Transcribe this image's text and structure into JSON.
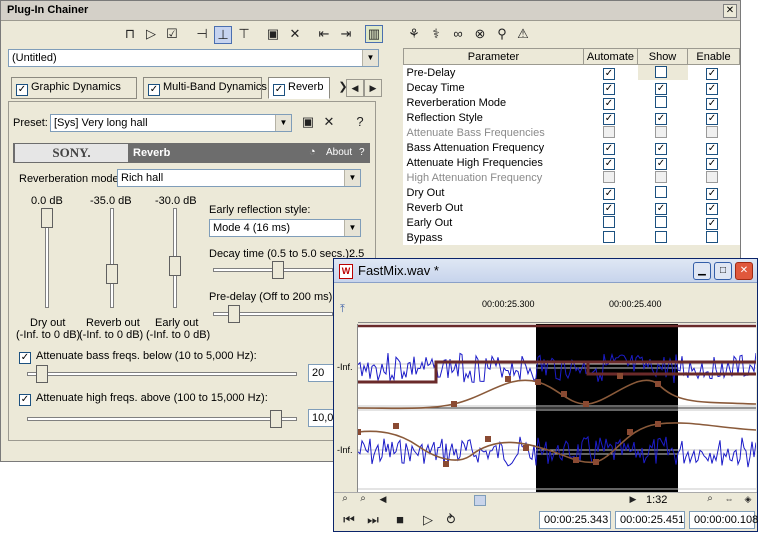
{
  "chainer": {
    "title": "Plug-In Chainer",
    "preset_combo": "(Untitled)",
    "tabs": [
      "Graphic Dynamics",
      "Multi-Band Dynamics",
      "Reverb"
    ],
    "preset_label": "Preset:",
    "preset_value": "[Sys] Very long hall",
    "brand": "SONY.",
    "plugin_name": "Reverb",
    "about_label": "About",
    "help_label": "?",
    "reverb_mode_label": "Reverberation mode:",
    "reverb_mode_value": "Rich hall",
    "slider_values": [
      "0.0 dB",
      "-35.0 dB",
      "-30.0 dB"
    ],
    "slider_levels": [
      0.0,
      -35.0,
      -30.0
    ],
    "slider_captions": [
      {
        "line1": "Dry out",
        "line2": "(-Inf. to 0 dB)"
      },
      {
        "line1": "Reverb out",
        "line2": "(-Inf. to 0 dB)"
      },
      {
        "line1": "Early out",
        "line2": "(-Inf. to 0 dB)"
      }
    ],
    "early_style_label": "Early reflection style:",
    "early_style_value": "Mode 4  (16 ms)",
    "decay_label": "Decay time (0.5 to 5.0 secs.):",
    "decay_value": "2.5",
    "predelay_label": "Pre-delay (Off to 200 ms):",
    "bass_label": "Attenuate bass freqs. below (10 to 5,000 Hz):",
    "bass_value": "20",
    "high_label": "Attenuate high freqs. above (100 to 15,000 Hz):",
    "high_value": "10,0"
  },
  "params": {
    "headers": [
      "Parameter",
      "Automate",
      "Show",
      "Enable"
    ],
    "rows": [
      {
        "name": "Pre-Delay",
        "automate": true,
        "show": false,
        "enable": true,
        "active": true
      },
      {
        "name": "Decay Time",
        "automate": true,
        "show": true,
        "enable": true,
        "active": true
      },
      {
        "name": "Reverberation Mode",
        "automate": true,
        "show": false,
        "enable": true,
        "active": true
      },
      {
        "name": "Reflection Style",
        "automate": true,
        "show": true,
        "enable": true,
        "active": true
      },
      {
        "name": "Attenuate Bass Frequencies",
        "automate": false,
        "show": false,
        "enable": false,
        "active": false
      },
      {
        "name": "Bass Attenuation Frequency",
        "automate": true,
        "show": true,
        "enable": true,
        "active": true
      },
      {
        "name": "Attenuate High Frequencies",
        "automate": true,
        "show": true,
        "enable": true,
        "active": true
      },
      {
        "name": "High Attenuation Frequency",
        "automate": false,
        "show": false,
        "enable": false,
        "active": false
      },
      {
        "name": "Dry Out",
        "automate": true,
        "show": false,
        "enable": true,
        "active": true
      },
      {
        "name": "Reverb Out",
        "automate": true,
        "show": true,
        "enable": true,
        "active": true
      },
      {
        "name": "Early Out",
        "automate": false,
        "show": false,
        "enable": true,
        "active": true
      },
      {
        "name": "Bypass",
        "automate": false,
        "show": false,
        "enable": false,
        "active": true
      }
    ]
  },
  "fastmix": {
    "title": "FastMix.wav *",
    "ruler_times": [
      "00:00:25.300",
      "00:00:25.400"
    ],
    "track_label": "-Inf.",
    "zoom": "1:32",
    "time_start": "00:00:25.343",
    "time_end": "00:00:25.451",
    "time_length": "00:00:00.108"
  },
  "colors": {
    "waveform": "#1c1cc8",
    "envelope": "#8a5a3a",
    "selection": "#000000",
    "banner": "#6d6d6d"
  }
}
